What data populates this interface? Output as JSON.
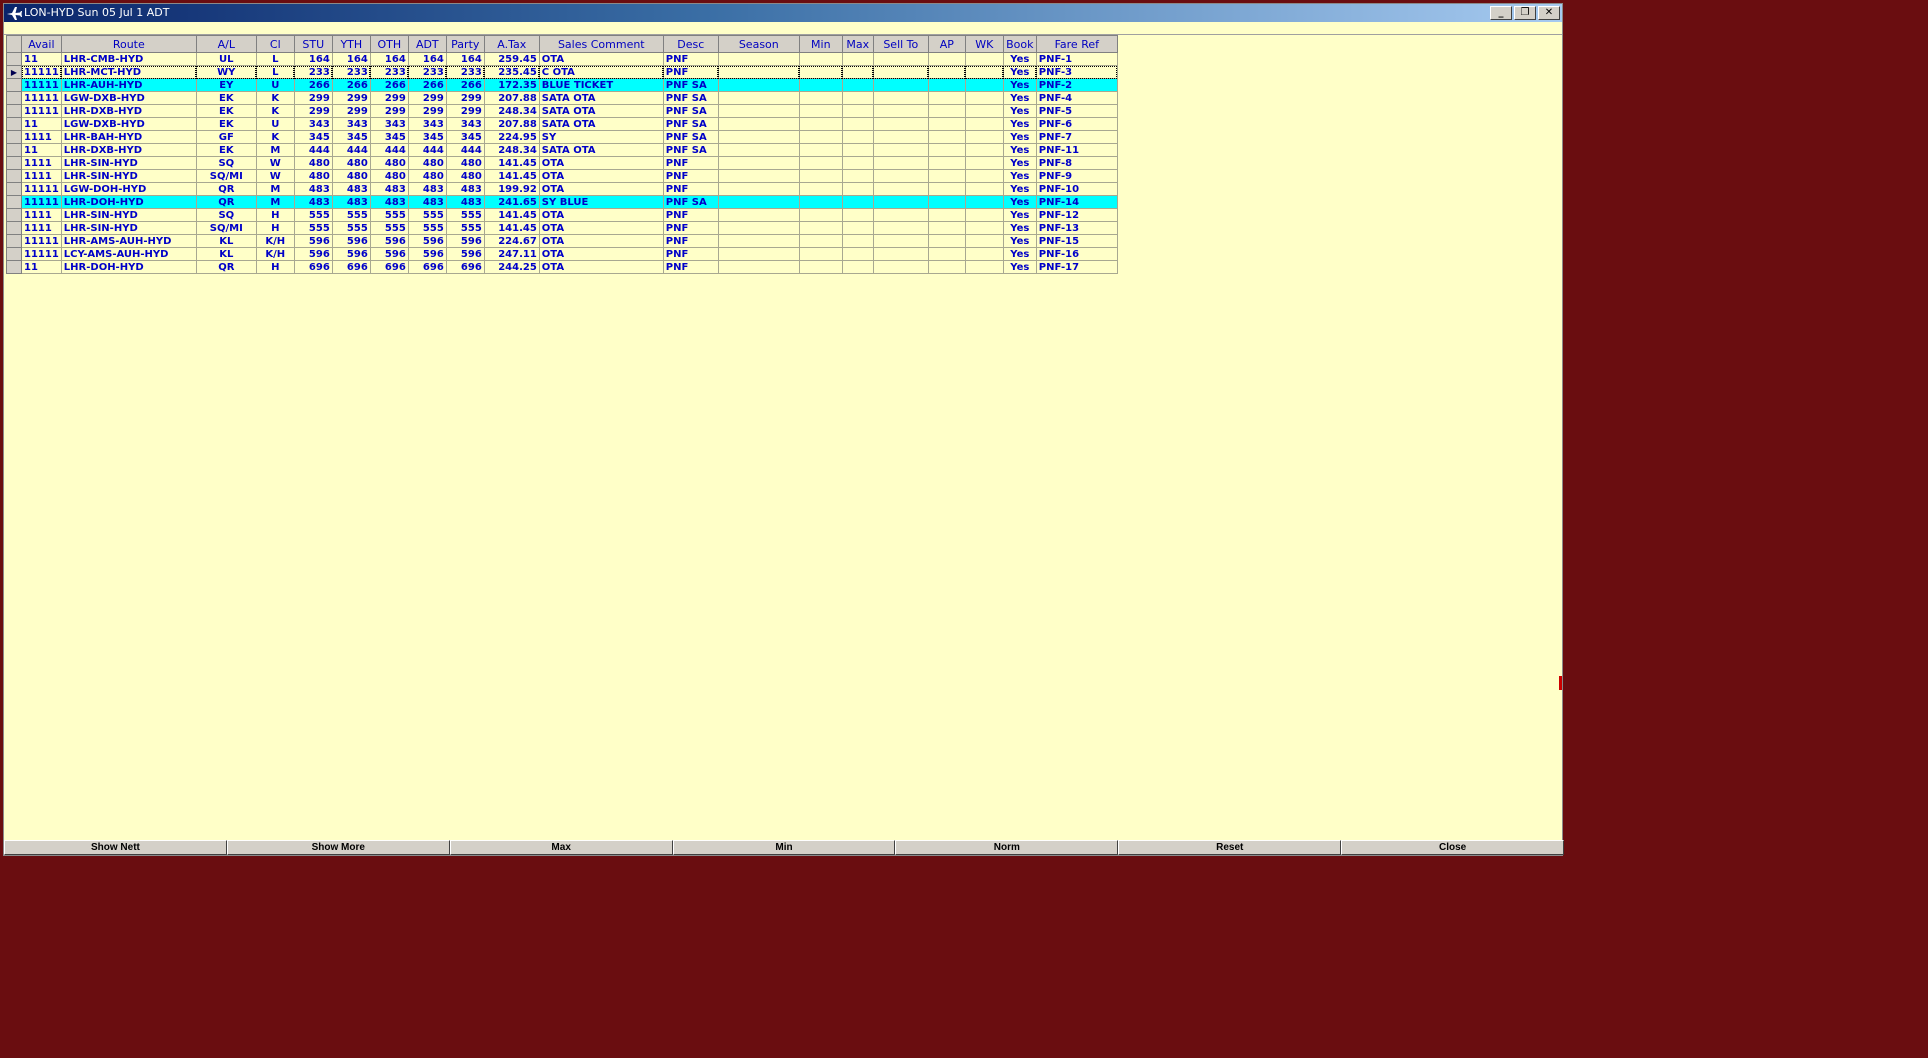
{
  "window": {
    "title": "LON-HYD Sun 05 Jul 1 ADT",
    "minimize": "_",
    "restore": "❐",
    "close": "✕"
  },
  "columns": [
    "Avail",
    "Route",
    "A/L",
    "Cl",
    "STU",
    "YTH",
    "OTH",
    "ADT",
    "Party",
    "A.Tax",
    "Sales Comment",
    "Desc",
    "Season",
    "Min",
    "Max",
    "Sell To",
    "AP",
    "WK",
    "Book",
    "Fare Ref"
  ],
  "rows": [
    {
      "avail": "11",
      "route": "LHR-CMB-HYD",
      "al": "UL",
      "cl": "L",
      "stu": "164",
      "yth": "164",
      "oth": "164",
      "adt": "164",
      "party": "164",
      "atax": "259.45",
      "comment": "OTA",
      "desc": "PNF",
      "season": "",
      "min": "",
      "max": "",
      "sellto": "",
      "ap": "",
      "wk": "",
      "book": "Yes",
      "ref": "PNF-1"
    },
    {
      "avail": "11111",
      "route": "LHR-MCT-HYD",
      "al": "WY",
      "cl": "L",
      "stu": "233",
      "yth": "233",
      "oth": "233",
      "adt": "233",
      "party": "233",
      "atax": "235.45",
      "comment": "C OTA",
      "desc": "PNF",
      "season": "",
      "min": "",
      "max": "",
      "sellto": "",
      "ap": "",
      "wk": "",
      "book": "Yes",
      "ref": "PNF-3"
    },
    {
      "avail": "11111",
      "route": "LHR-AUH-HYD",
      "al": "EY",
      "cl": "U",
      "stu": "266",
      "yth": "266",
      "oth": "266",
      "adt": "266",
      "party": "266",
      "atax": "172.35",
      "comment": "BLUE TICKET",
      "desc": "PNF SA",
      "season": "",
      "min": "",
      "max": "",
      "sellto": "",
      "ap": "",
      "wk": "",
      "book": "Yes",
      "ref": "PNF-2"
    },
    {
      "avail": "11111",
      "route": "LGW-DXB-HYD",
      "al": "EK",
      "cl": "K",
      "stu": "299",
      "yth": "299",
      "oth": "299",
      "adt": "299",
      "party": "299",
      "atax": "207.88",
      "comment": "SATA OTA",
      "desc": "PNF SA",
      "season": "",
      "min": "",
      "max": "",
      "sellto": "",
      "ap": "",
      "wk": "",
      "book": "Yes",
      "ref": "PNF-4"
    },
    {
      "avail": "11111",
      "route": "LHR-DXB-HYD",
      "al": "EK",
      "cl": "K",
      "stu": "299",
      "yth": "299",
      "oth": "299",
      "adt": "299",
      "party": "299",
      "atax": "248.34",
      "comment": "SATA OTA",
      "desc": "PNF SA",
      "season": "",
      "min": "",
      "max": "",
      "sellto": "",
      "ap": "",
      "wk": "",
      "book": "Yes",
      "ref": "PNF-5"
    },
    {
      "avail": "11",
      "route": "LGW-DXB-HYD",
      "al": "EK",
      "cl": "U",
      "stu": "343",
      "yth": "343",
      "oth": "343",
      "adt": "343",
      "party": "343",
      "atax": "207.88",
      "comment": "SATA OTA",
      "desc": "PNF SA",
      "season": "",
      "min": "",
      "max": "",
      "sellto": "",
      "ap": "",
      "wk": "",
      "book": "Yes",
      "ref": "PNF-6"
    },
    {
      "avail": "1111",
      "route": "LHR-BAH-HYD",
      "al": "GF",
      "cl": "K",
      "stu": "345",
      "yth": "345",
      "oth": "345",
      "adt": "345",
      "party": "345",
      "atax": "224.95",
      "comment": "SY",
      "desc": "PNF SA",
      "season": "",
      "min": "",
      "max": "",
      "sellto": "",
      "ap": "",
      "wk": "",
      "book": "Yes",
      "ref": "PNF-7"
    },
    {
      "avail": "11",
      "route": "LHR-DXB-HYD",
      "al": "EK",
      "cl": "M",
      "stu": "444",
      "yth": "444",
      "oth": "444",
      "adt": "444",
      "party": "444",
      "atax": "248.34",
      "comment": "SATA OTA",
      "desc": "PNF SA",
      "season": "",
      "min": "",
      "max": "",
      "sellto": "",
      "ap": "",
      "wk": "",
      "book": "Yes",
      "ref": "PNF-11"
    },
    {
      "avail": "1111",
      "route": "LHR-SIN-HYD",
      "al": "SQ",
      "cl": "W",
      "stu": "480",
      "yth": "480",
      "oth": "480",
      "adt": "480",
      "party": "480",
      "atax": "141.45",
      "comment": "OTA",
      "desc": "PNF",
      "season": "",
      "min": "",
      "max": "",
      "sellto": "",
      "ap": "",
      "wk": "",
      "book": "Yes",
      "ref": "PNF-8"
    },
    {
      "avail": "1111",
      "route": "LHR-SIN-HYD",
      "al": "SQ/MI",
      "cl": "W",
      "stu": "480",
      "yth": "480",
      "oth": "480",
      "adt": "480",
      "party": "480",
      "atax": "141.45",
      "comment": "OTA",
      "desc": "PNF",
      "season": "",
      "min": "",
      "max": "",
      "sellto": "",
      "ap": "",
      "wk": "",
      "book": "Yes",
      "ref": "PNF-9"
    },
    {
      "avail": "11111",
      "route": "LGW-DOH-HYD",
      "al": "QR",
      "cl": "M",
      "stu": "483",
      "yth": "483",
      "oth": "483",
      "adt": "483",
      "party": "483",
      "atax": "199.92",
      "comment": "OTA",
      "desc": "PNF",
      "season": "",
      "min": "",
      "max": "",
      "sellto": "",
      "ap": "",
      "wk": "",
      "book": "Yes",
      "ref": "PNF-10"
    },
    {
      "avail": "11111",
      "route": "LHR-DOH-HYD",
      "al": "QR",
      "cl": "M",
      "stu": "483",
      "yth": "483",
      "oth": "483",
      "adt": "483",
      "party": "483",
      "atax": "241.65",
      "comment": "SY BLUE",
      "desc": "PNF SA",
      "season": "",
      "min": "",
      "max": "",
      "sellto": "",
      "ap": "",
      "wk": "",
      "book": "Yes",
      "ref": "PNF-14"
    },
    {
      "avail": "1111",
      "route": "LHR-SIN-HYD",
      "al": "SQ",
      "cl": "H",
      "stu": "555",
      "yth": "555",
      "oth": "555",
      "adt": "555",
      "party": "555",
      "atax": "141.45",
      "comment": "OTA",
      "desc": "PNF",
      "season": "",
      "min": "",
      "max": "",
      "sellto": "",
      "ap": "",
      "wk": "",
      "book": "Yes",
      "ref": "PNF-12"
    },
    {
      "avail": "1111",
      "route": "LHR-SIN-HYD",
      "al": "SQ/MI",
      "cl": "H",
      "stu": "555",
      "yth": "555",
      "oth": "555",
      "adt": "555",
      "party": "555",
      "atax": "141.45",
      "comment": "OTA",
      "desc": "PNF",
      "season": "",
      "min": "",
      "max": "",
      "sellto": "",
      "ap": "",
      "wk": "",
      "book": "Yes",
      "ref": "PNF-13"
    },
    {
      "avail": "11111",
      "route": "LHR-AMS-AUH-HYD",
      "al": "KL",
      "cl": "K/H",
      "stu": "596",
      "yth": "596",
      "oth": "596",
      "adt": "596",
      "party": "596",
      "atax": "224.67",
      "comment": "OTA",
      "desc": "PNF",
      "season": "",
      "min": "",
      "max": "",
      "sellto": "",
      "ap": "",
      "wk": "",
      "book": "Yes",
      "ref": "PNF-15"
    },
    {
      "avail": "11111",
      "route": "LCY-AMS-AUH-HYD",
      "al": "KL",
      "cl": "K/H",
      "stu": "596",
      "yth": "596",
      "oth": "596",
      "adt": "596",
      "party": "596",
      "atax": "247.11",
      "comment": "OTA",
      "desc": "PNF",
      "season": "",
      "min": "",
      "max": "",
      "sellto": "",
      "ap": "",
      "wk": "",
      "book": "Yes",
      "ref": "PNF-16"
    },
    {
      "avail": "11",
      "route": "LHR-DOH-HYD",
      "al": "QR",
      "cl": "H",
      "stu": "696",
      "yth": "696",
      "oth": "696",
      "adt": "696",
      "party": "696",
      "atax": "244.25",
      "comment": "OTA",
      "desc": "PNF",
      "season": "",
      "min": "",
      "max": "",
      "sellto": "",
      "ap": "",
      "wk": "",
      "book": "Yes",
      "ref": "PNF-17"
    }
  ],
  "highlighted_rows": [
    2,
    11
  ],
  "current_row": 1,
  "colors": {
    "highlight": "#00ffff",
    "background": "#ffffc8",
    "text": "#0000c8"
  },
  "buttons": [
    "Show Nett",
    "Show More",
    "Max",
    "Min",
    "Norm",
    "Reset",
    "Close"
  ]
}
